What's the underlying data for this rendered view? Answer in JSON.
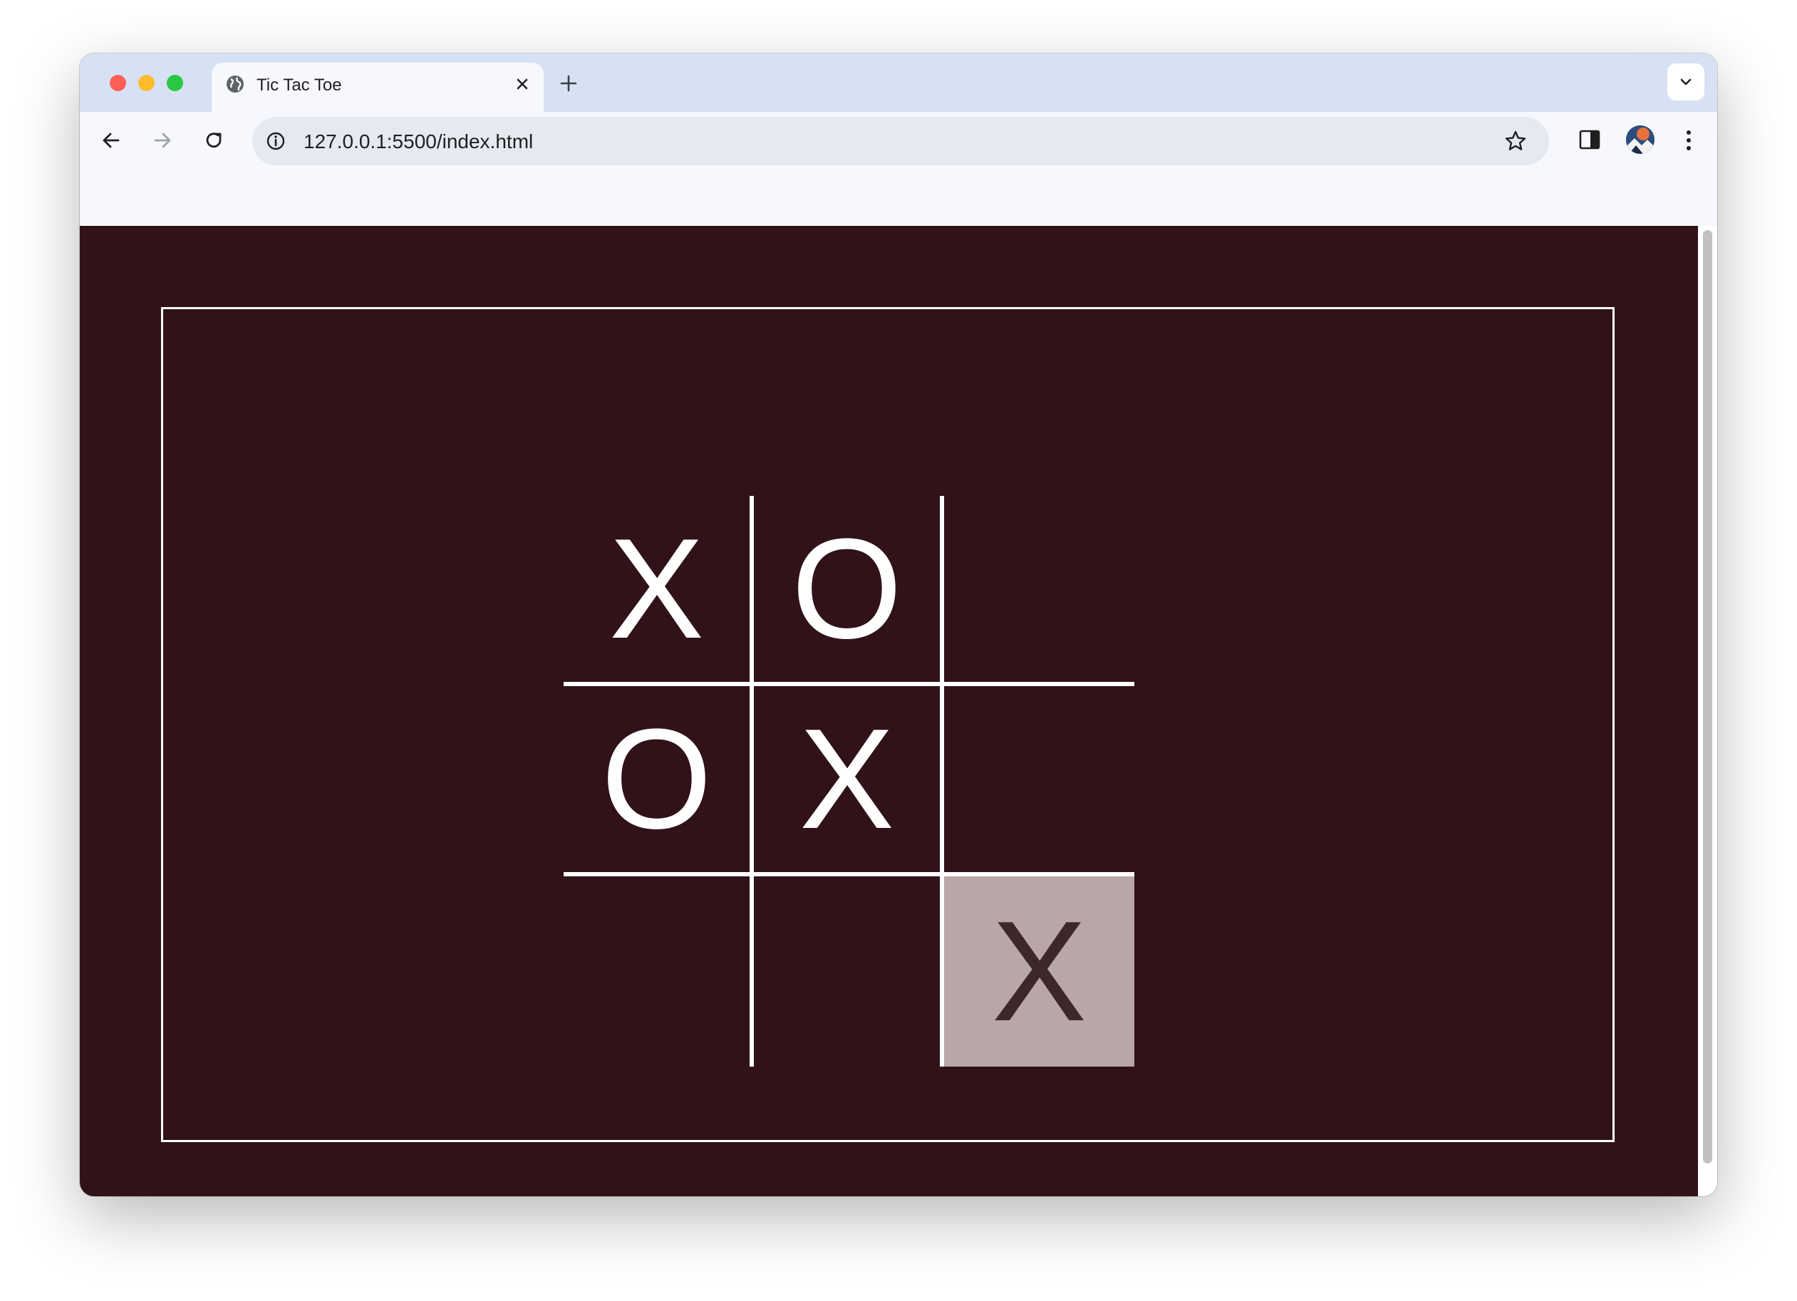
{
  "browser": {
    "tab_title": "Tic Tac Toe",
    "url": "127.0.0.1:5500/index.html",
    "icons": {
      "tab_favicon": "globe-icon",
      "tab_close": "close-icon",
      "new_tab": "plus-icon",
      "tab_search": "chevron-down-icon",
      "back": "arrow-left-icon",
      "forward": "arrow-right-icon",
      "reload": "reload-icon",
      "site_info": "info-icon",
      "bookmark": "star-icon",
      "side_panel": "side-panel-icon",
      "profile": "avatar",
      "menu": "kebab-menu-icon"
    }
  },
  "game": {
    "cells": [
      "X",
      "O",
      "",
      "O",
      "X",
      "",
      "",
      "",
      "X"
    ],
    "highlighted_cell": 8
  },
  "colors": {
    "page_background": "#301218",
    "grid_lines": "#ffffff",
    "mark": "#ffffff",
    "highlight_background": "#b9a7a7",
    "highlight_mark": "#3d2829"
  }
}
